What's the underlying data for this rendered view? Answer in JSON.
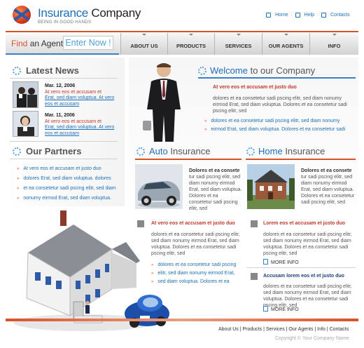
{
  "brand": {
    "title_word1": "Insurance",
    "title_word2": "Company",
    "tagline": "BEING IN GOOD HANDS"
  },
  "top_links": {
    "home": "Home",
    "help": "Help",
    "contacts": "Contacts"
  },
  "find": {
    "word1": "Find",
    "word2": "an Agent",
    "button": "Enter Now !"
  },
  "nav": [
    "ABOUT US",
    "PRODUCTS",
    "SERVICES",
    "OUR AGENTS",
    "INFO"
  ],
  "latest_news": {
    "heading": "Latest News",
    "items": [
      {
        "date": "Mar. 12, 2006",
        "red": "At vero eos et accusam et",
        "link": "Erat, sed diam voluptua. At vero eos et accusam"
      },
      {
        "date": "Mar. 11, 2006",
        "red": "At vero eos et accusam et",
        "link": "Erat, sed diam voluptua. At vero eos et accusam"
      }
    ]
  },
  "partners": {
    "heading": "Our Partners",
    "items": [
      "At vero eos et accusam et justo duo",
      "dolores Erat, sed diam voluptua. dolores",
      "et ea consetetur sadi pscing elitr, sed diam",
      "nonumy eirmod Erat, sed diam voluptua."
    ]
  },
  "welcome": {
    "title_word1": "Welcome",
    "title_word2": "to our Company",
    "sub": "At vero eos et accusam et justo duo",
    "para": "dolores et ea consetetur sadi pscing elitr, sed diam nonumy eirmod Erat, sed diam voluptua. Dolores et ea consetetur sadi pscing elitr, sed",
    "links": [
      "dolores et ea consetetur sadi pscing elitr, sed diam nonumy",
      "eirmod Erat, sed diam voluptua. Dolores et ea consetetur sadi"
    ]
  },
  "auto": {
    "title_word1": "Auto",
    "title_word2": "Insurance",
    "img_lead": "Dolores et ea consete",
    "img_text": "tur sadi pscing elitr, sed diam nonumy eirmod Erat, sed diam voluptua. Dolores et ea consetetur sadi pscing elitr, sed",
    "sub": "At vero eos et accusam et justo duo",
    "para": "dolores et ea consetetur sadi pscing elitr, sed diam nonumy eirmod Erat, sed diam voluptua. Dolores et ea consetetur sadi pscing elitr, sed",
    "links": [
      "dolores et ea consetetur sadi pscing",
      "elitr, sed diam nonumy eirmod Erat,",
      "sed diam voluptua. Dolores et ea"
    ]
  },
  "home": {
    "title_word1": "Home",
    "title_word2": "Insurance",
    "img_lead": "Dolores et ea consete",
    "img_text": "tur sadi pscing elitr, sed diam nonumy eirmod Erat, sed diam voluptua. Dolores et ea consetetur sadi pscing elitr, sed",
    "sub1": "Lorem eos et accusam et justo duo",
    "para1": "dolores et ea consetetur sadi pscing elitr, sed diam nonumy eirmod Erat, sed diam voluptua. Dolores et ea consetetur sadi pscing elitr, sed",
    "more1": "MORE INFO",
    "sub2": "Accusam lorem eos et et justo duo",
    "para2": "dolores et ea consetetur sadi pscing elitr, sed diam nonumy eirmod Erat, sed diam voluptua. Dolores et ea consetetur sadi pscing elitr, sed",
    "more2": "MORE INFO"
  },
  "footer": {
    "links": [
      "About Us",
      "Products",
      "Services",
      "Our Agents",
      "Info",
      "Contacts"
    ],
    "copyright": "Copyright © Your Company Name"
  },
  "colors": {
    "accent": "#d6532a",
    "brand": "#1d6fb8",
    "link_blue": "#1d6fb8"
  }
}
